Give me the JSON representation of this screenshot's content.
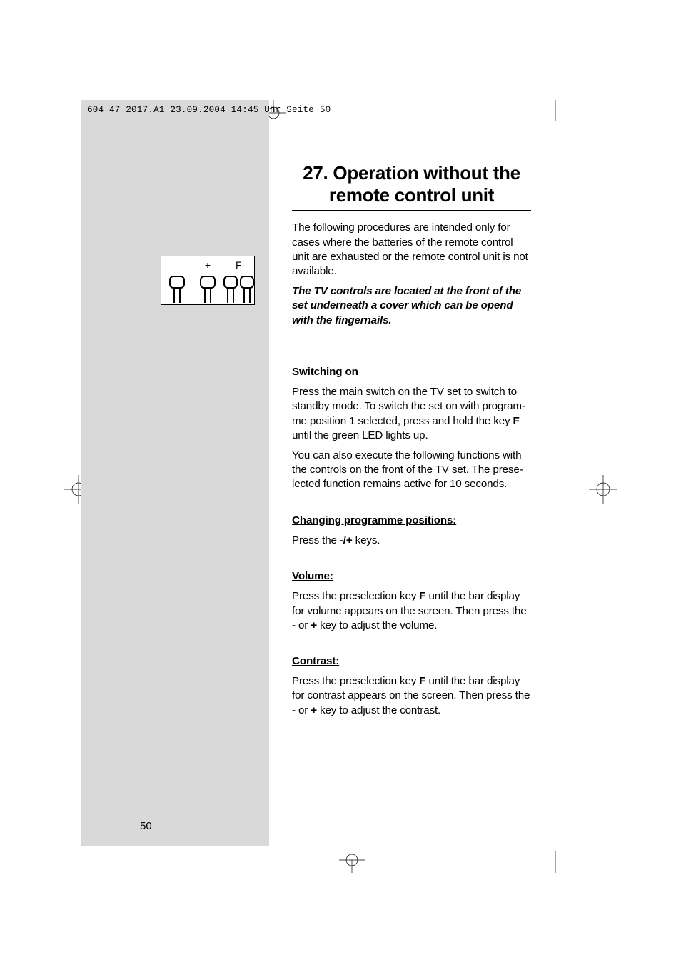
{
  "header": "604 47 2017.A1  23.09.2004  14:45 Uhr  Seite 50",
  "diagram": {
    "minus": "–",
    "plus": "+",
    "f": "F"
  },
  "title_line1": "27. Operation without the",
  "title_line2": "remote control unit",
  "intro": "The following procedures are intended only for cases where the batteries of the remote control unit are exhausted or the remote control unit is not available.",
  "note": "The TV controls are located at the front of the set underneath a cover which can be opend with the fingernails.",
  "sections": {
    "switching": {
      "heading": "Switching on",
      "p1a": "Press the main switch on the TV set to switch to standby mode. To switch the set on with program­me position 1 selected, press and hold the key ",
      "p1key": "F",
      "p1b": " until the green LED lights up.",
      "p2": "You can also execute the following functions with the controls on the front of the TV set. The prese­lected function remains active for 10 seconds."
    },
    "changing": {
      "heading": "Changing programme positions:",
      "p1a": "Press the ",
      "p1key": "-/+",
      "p1b": " keys."
    },
    "volume": {
      "heading": "Volume:",
      "p1a": "Press the preselection key ",
      "p1key": "F",
      "p1b": " until the bar display for volume appears on the screen. Then press the ",
      "p1key2": "-",
      "p1c": " or ",
      "p1key3": "+",
      "p1d": " key to adjust the volume."
    },
    "contrast": {
      "heading": "Contrast:",
      "p1a": "Press the preselection key ",
      "p1key": "F",
      "p1b": "  until the bar display for contrast appears on the screen. Then press the ",
      "p1key2": "-",
      "p1c": " or ",
      "p1key3": "+",
      "p1d": " key to adjust the contrast."
    }
  },
  "page_number": "50"
}
